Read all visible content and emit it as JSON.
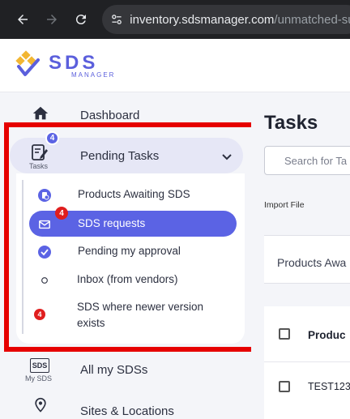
{
  "browser": {
    "url_host": "inventory.sdsmanager.com",
    "url_path": "/unmatched-sub"
  },
  "logo": {
    "title": "SDS",
    "subtitle": "MANAGER"
  },
  "sidebar": {
    "dashboard_label": "Dashboard",
    "tasks_icon_caption": "Tasks",
    "pending_label": "Pending Tasks",
    "pending_badge": "4",
    "sub_items": [
      {
        "label": "Products Awaiting SDS",
        "icon": "bag-clock-icon",
        "badge": ""
      },
      {
        "label": "SDS requests",
        "icon": "envelope-icon",
        "badge": "4"
      },
      {
        "label": "Pending my approval",
        "icon": "check-circle-icon",
        "badge": ""
      },
      {
        "label": "Inbox (from vendors)",
        "icon": "empty-circle-icon",
        "badge": ""
      },
      {
        "label_line1": "SDS where newer version",
        "label_line2": "exists",
        "icon": "red-badge-icon",
        "badge": "4"
      }
    ],
    "my_sds_icon_text": "SDS",
    "my_sds_caption": "My SDS",
    "all_sds_label": "All my SDSs",
    "sites_label": "Sites & Locations"
  },
  "main": {
    "title": "Tasks",
    "search_placeholder": "Search for Ta",
    "import_label": "Import File",
    "tab_label": "Products Awa",
    "column_header": "Produc",
    "rows": [
      {
        "name": "TEST123"
      }
    ]
  },
  "colors": {
    "accent": "#5b63e4",
    "badge_red": "#e01e1e",
    "highlight": "#e60000"
  }
}
